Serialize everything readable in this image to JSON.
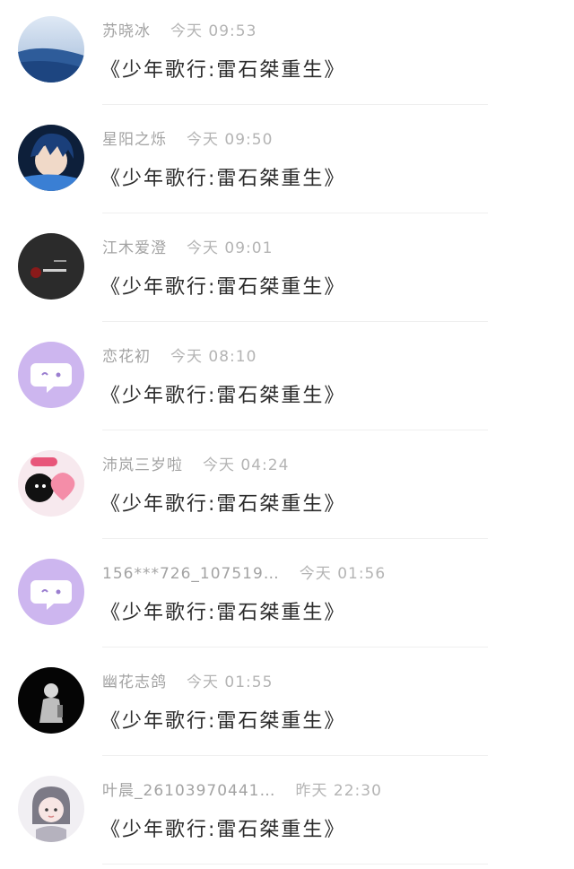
{
  "comments": [
    {
      "user": "苏晓冰",
      "time": "今天 09:53",
      "message": "《少年歌行:雷石桀重生》",
      "avatar_icon": "blue-landscape-avatar"
    },
    {
      "user": "星阳之烁",
      "time": "今天 09:50",
      "message": "《少年歌行:雷石桀重生》",
      "avatar_icon": "anime-boy-avatar"
    },
    {
      "user": "江木爱澄",
      "time": "今天 09:01",
      "message": "《少年歌行:雷石桀重生》",
      "avatar_icon": "dark-photo-avatar"
    },
    {
      "user": "恋花初",
      "time": "今天 08:10",
      "message": "《少年歌行:雷石桀重生》",
      "avatar_icon": "default-chat-avatar"
    },
    {
      "user": "沛岚三岁啦",
      "time": "今天 04:24",
      "message": "《少年歌行:雷石桀重生》",
      "avatar_icon": "i-luv-u-avatar"
    },
    {
      "user": "156***726_107519…",
      "time": "今天 01:56",
      "message": "《少年歌行:雷石桀重生》",
      "avatar_icon": "default-chat-avatar"
    },
    {
      "user": "幽花志鸽",
      "time": "今天 01:55",
      "message": "《少年歌行:雷石桀重生》",
      "avatar_icon": "dark-figure-avatar"
    },
    {
      "user": "叶晨_26103970441…",
      "time": "昨天 22:30",
      "message": "《少年歌行:雷石桀重生》",
      "avatar_icon": "anime-girl-avatar"
    }
  ],
  "colors": {
    "default_avatar_bg": "#cdb6ef",
    "meta_text": "#a3a3a3",
    "message_text": "#2c2c2c"
  }
}
